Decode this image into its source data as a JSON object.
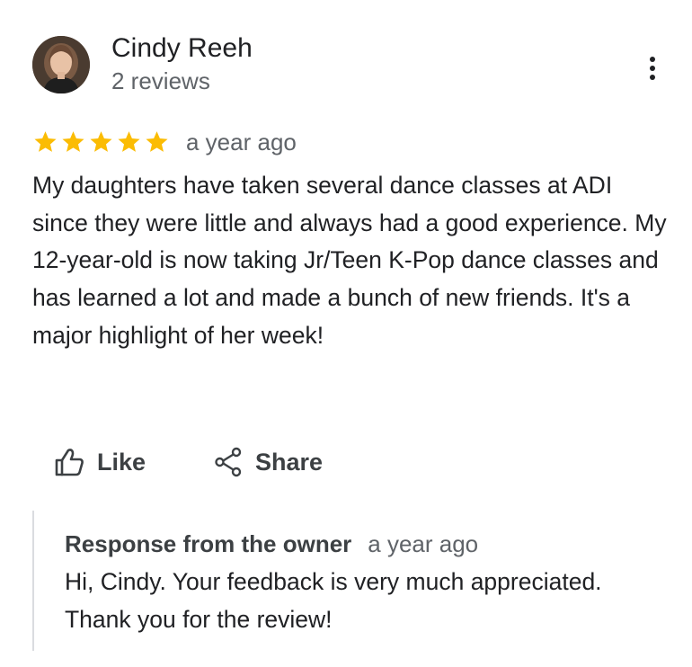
{
  "reviewer": {
    "name": "Cindy Reeh",
    "review_count": "2 reviews"
  },
  "review": {
    "rating": 5,
    "rating_max": 5,
    "date": "a year ago",
    "text": "My daughters have taken several dance classes at ADI since they were little and always had a good experience. My 12-year-old is now taking Jr/Teen K-Pop dance classes and has learned a lot and made a bunch of new friends. It's a major highlight of her week!"
  },
  "actions": {
    "like_label": "Like",
    "share_label": "Share"
  },
  "owner_response": {
    "title": "Response from the owner",
    "date": "a year ago",
    "text": "Hi, Cindy. Your feedback is very much appreciated. Thank you for the review!"
  },
  "icons": {
    "menu": "more-vert-icon",
    "like": "thumb-up-icon",
    "share": "share-icon",
    "star": "star-icon"
  },
  "colors": {
    "star": "#fbbc04",
    "text_primary": "#202124",
    "text_secondary": "#5f6368",
    "divider": "#dadce0"
  }
}
